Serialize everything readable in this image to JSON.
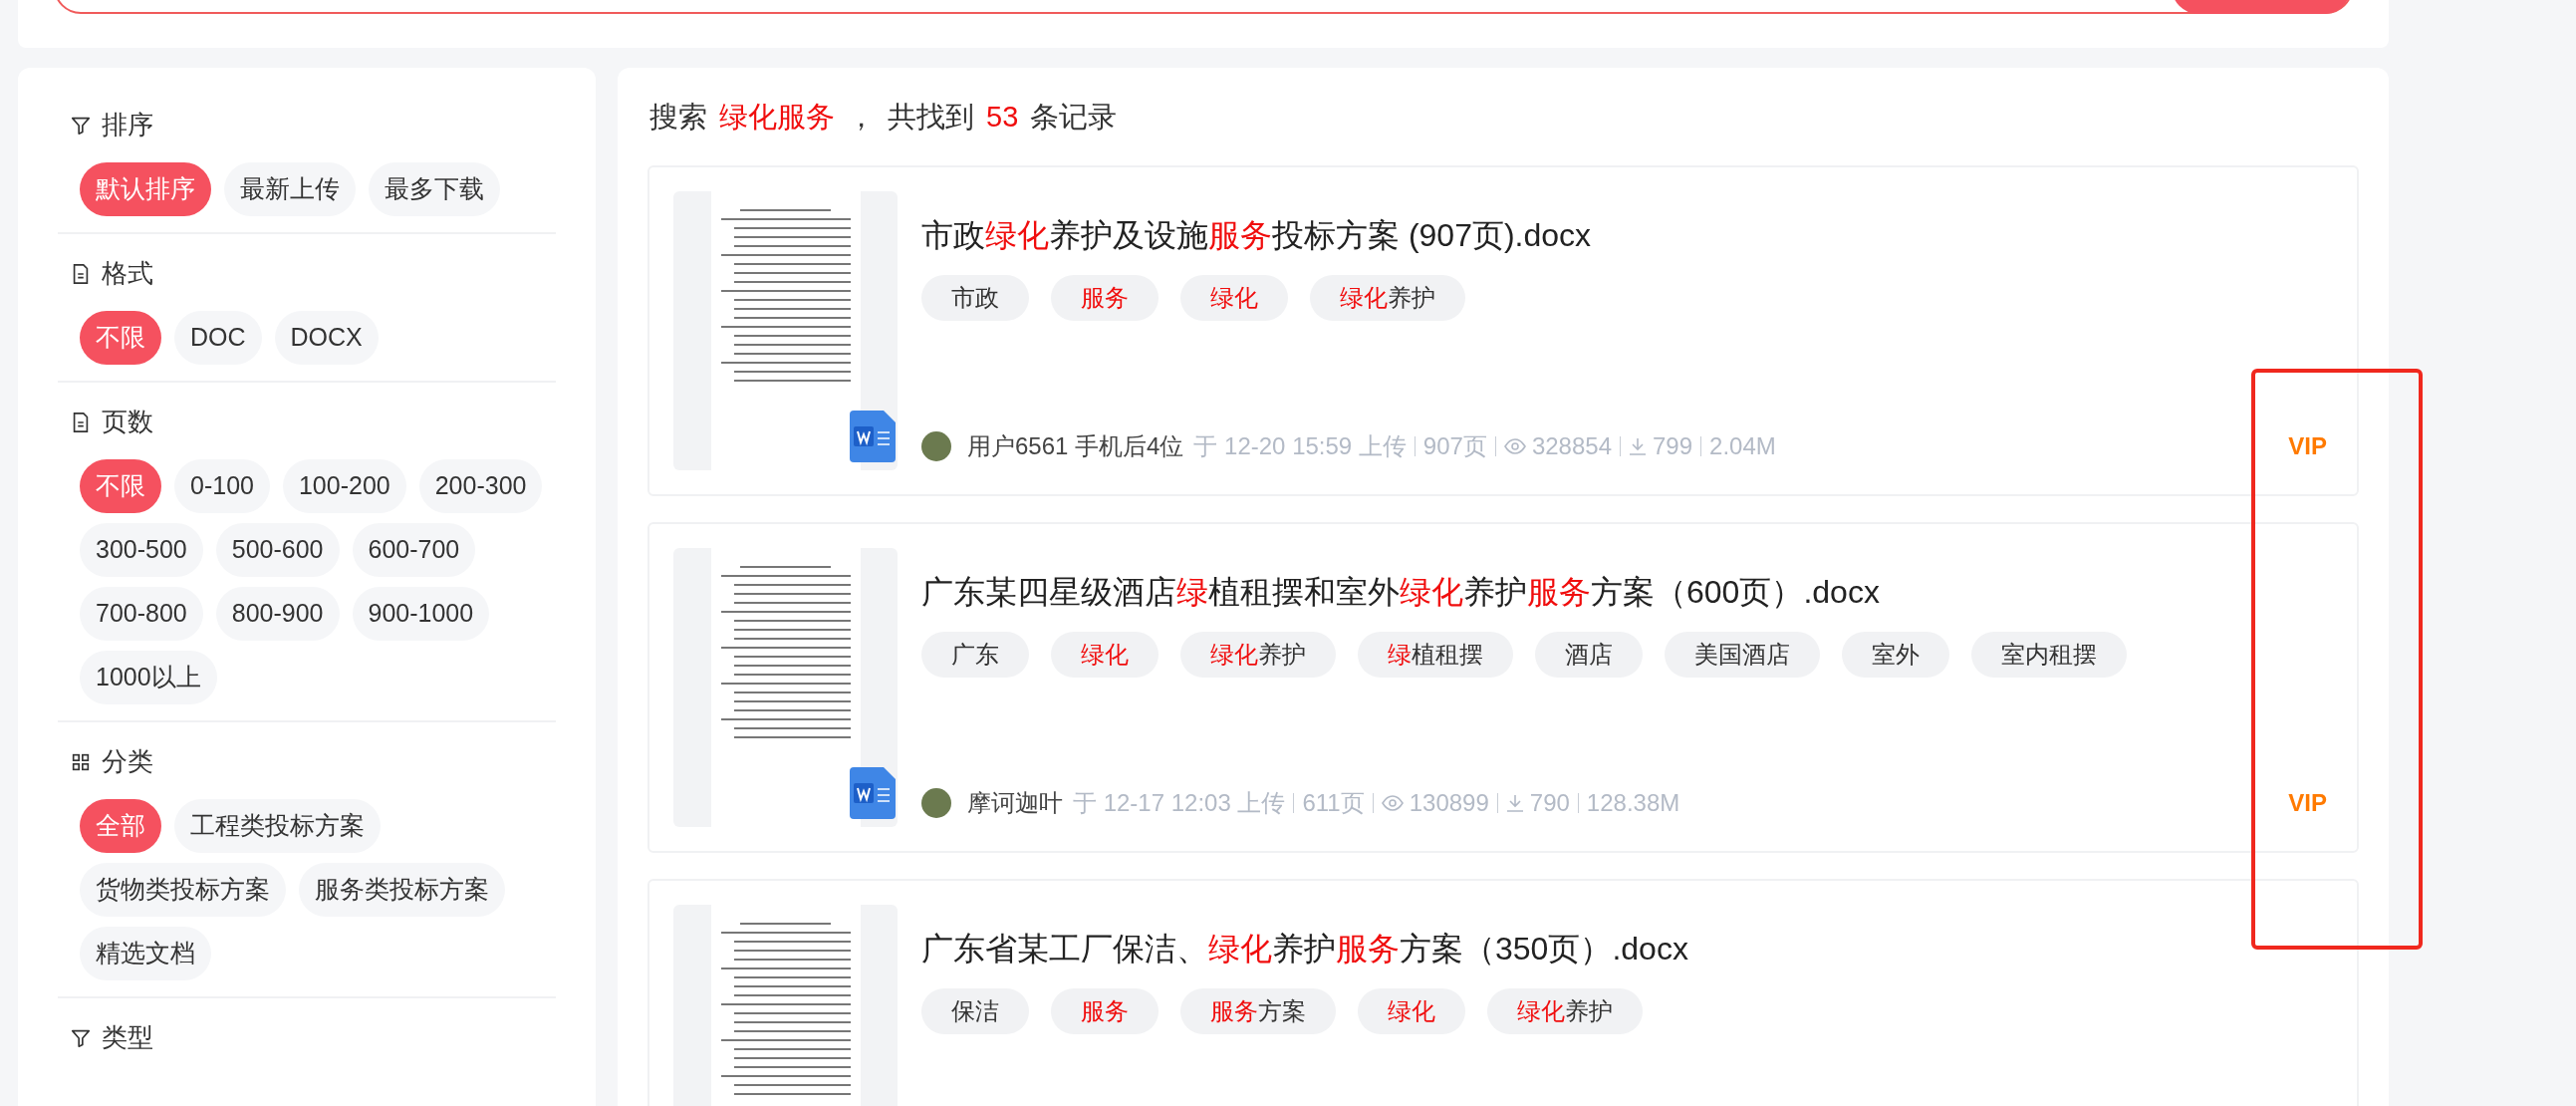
{
  "sidebar": {
    "sections": [
      {
        "kind": "filter",
        "title": "排序",
        "options": [
          {
            "label": "默认排序",
            "selected": true
          },
          {
            "label": "最新上传",
            "selected": false
          },
          {
            "label": "最多下载",
            "selected": false
          }
        ]
      },
      {
        "kind": "file",
        "title": "格式",
        "options": [
          {
            "label": "不限",
            "selected": true
          },
          {
            "label": "DOC",
            "selected": false
          },
          {
            "label": "DOCX",
            "selected": false
          }
        ]
      },
      {
        "kind": "file",
        "title": "页数",
        "options": [
          {
            "label": "不限",
            "selected": true
          },
          {
            "label": "0-100",
            "selected": false
          },
          {
            "label": "100-200",
            "selected": false
          },
          {
            "label": "200-300",
            "selected": false
          },
          {
            "label": "300-500",
            "selected": false
          },
          {
            "label": "500-600",
            "selected": false
          },
          {
            "label": "600-700",
            "selected": false
          },
          {
            "label": "700-800",
            "selected": false
          },
          {
            "label": "800-900",
            "selected": false
          },
          {
            "label": "900-1000",
            "selected": false
          },
          {
            "label": "1000以上",
            "selected": false
          }
        ]
      },
      {
        "kind": "grid",
        "title": "分类",
        "options": [
          {
            "label": "全部",
            "selected": true
          },
          {
            "label": "工程类投标方案",
            "selected": false
          },
          {
            "label": "货物类投标方案",
            "selected": false
          },
          {
            "label": "服务类投标方案",
            "selected": false
          },
          {
            "label": "精选文档",
            "selected": false
          }
        ]
      },
      {
        "kind": "filter",
        "title": "类型"
      }
    ]
  },
  "summary": [
    {
      "text": "搜索",
      "highlight": false
    },
    {
      "text": "绿化服务",
      "highlight": true
    },
    {
      "text": "，",
      "highlight": false
    },
    {
      "text": "共找到",
      "highlight": false
    },
    {
      "text": "53",
      "highlight": true
    },
    {
      "text": "条记录",
      "highlight": false
    }
  ],
  "results": [
    {
      "title": [
        {
          "text": "市政",
          "highlight": false
        },
        {
          "text": "绿化",
          "highlight": true
        },
        {
          "text": "养护及设施",
          "highlight": false
        },
        {
          "text": "服务",
          "highlight": true
        },
        {
          "text": "投标方案 (907页).docx",
          "highlight": false
        }
      ],
      "tags": [
        [
          {
            "text": "市政",
            "highlight": false
          }
        ],
        [
          {
            "text": "服务",
            "highlight": true
          }
        ],
        [
          {
            "text": "绿化",
            "highlight": true
          }
        ],
        [
          {
            "text": "绿化",
            "highlight": true
          },
          {
            "text": "养护",
            "highlight": false
          }
        ]
      ],
      "meta": {
        "user": "用户6561 手机后4位",
        "uploaded": "于 12-20 15:59 上传",
        "pages": "907页",
        "views": "328854",
        "downloads": "799",
        "size": "2.04M"
      },
      "badge": "VIP"
    },
    {
      "title": [
        {
          "text": "广东某四星级酒店",
          "highlight": false
        },
        {
          "text": "绿",
          "highlight": true
        },
        {
          "text": "植租摆和室外",
          "highlight": false
        },
        {
          "text": "绿化",
          "highlight": true
        },
        {
          "text": "养护",
          "highlight": false
        },
        {
          "text": "服务",
          "highlight": true
        },
        {
          "text": "方案（600页）.docx",
          "highlight": false
        }
      ],
      "tags": [
        [
          {
            "text": "广东",
            "highlight": false
          }
        ],
        [
          {
            "text": "绿化",
            "highlight": true
          }
        ],
        [
          {
            "text": "绿化",
            "highlight": true
          },
          {
            "text": "养护",
            "highlight": false
          }
        ],
        [
          {
            "text": "绿",
            "highlight": true
          },
          {
            "text": "植租摆",
            "highlight": false
          }
        ],
        [
          {
            "text": "酒店",
            "highlight": false
          }
        ],
        [
          {
            "text": "美国酒店",
            "highlight": false
          }
        ],
        [
          {
            "text": "室外",
            "highlight": false
          }
        ],
        [
          {
            "text": "室内租摆",
            "highlight": false
          }
        ]
      ],
      "meta": {
        "user": "摩诃迦叶",
        "uploaded": "于 12-17 12:03 上传",
        "pages": "611页",
        "views": "130899",
        "downloads": "790",
        "size": "128.38M"
      },
      "badge": "VIP"
    },
    {
      "title": [
        {
          "text": "广东省某工厂保洁、",
          "highlight": false
        },
        {
          "text": "绿化",
          "highlight": true
        },
        {
          "text": "养护",
          "highlight": false
        },
        {
          "text": "服务",
          "highlight": true
        },
        {
          "text": "方案（350页）.docx",
          "highlight": false
        }
      ],
      "tags": [
        [
          {
            "text": "保洁",
            "highlight": false
          }
        ],
        [
          {
            "text": "服务",
            "highlight": true
          }
        ],
        [
          {
            "text": "服务",
            "highlight": true
          },
          {
            "text": "方案",
            "highlight": false
          }
        ],
        [
          {
            "text": "绿化",
            "highlight": true
          }
        ],
        [
          {
            "text": "绿化",
            "highlight": true
          },
          {
            "text": "养护",
            "highlight": false
          }
        ]
      ]
    }
  ]
}
